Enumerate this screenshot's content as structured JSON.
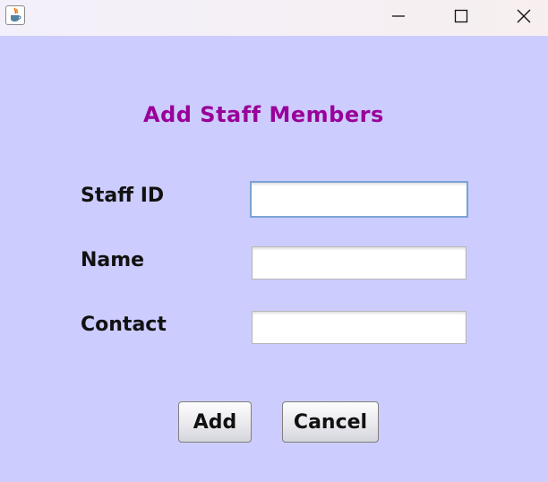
{
  "window": {
    "controls": {
      "minimize_icon": "minimize-icon",
      "maximize_icon": "maximize-icon",
      "close_icon": "close-icon"
    },
    "app_icon": "java-icon"
  },
  "form": {
    "title": "Add Staff Members",
    "title_color": "#990099",
    "background_color": "#ccccff",
    "fields": [
      {
        "label": "Staff ID",
        "value": "",
        "focused": true
      },
      {
        "label": "Name",
        "value": ""
      },
      {
        "label": "Contact",
        "value": ""
      }
    ],
    "buttons": {
      "add_label": "Add",
      "cancel_label": "Cancel"
    }
  }
}
